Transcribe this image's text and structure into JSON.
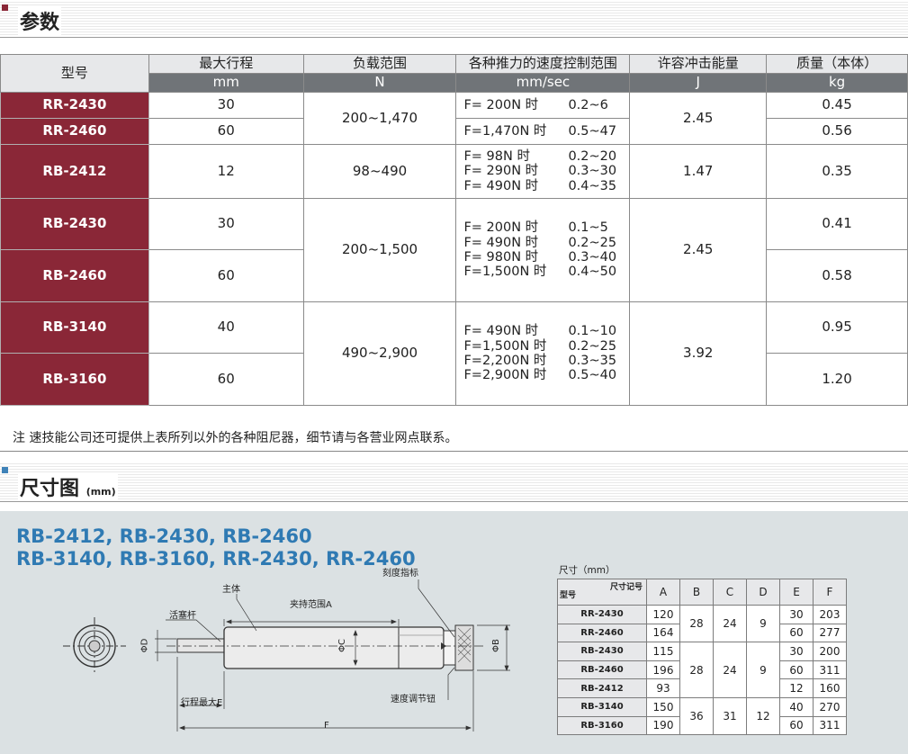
{
  "colors": {
    "accent_red": "#8a2737",
    "accent_blue": "#2f7ab3",
    "header_dark": "#707478",
    "section_square_1": "#8a2737",
    "section_square_2": "#3f82b8"
  },
  "sections": {
    "params": "参数",
    "dims": "尺寸图",
    "dims_unit": "(mm)"
  },
  "spec": {
    "headers": [
      "型号",
      "最大行程",
      "负载范围",
      "各种推力的速度控制范围",
      "许容冲击能量",
      "质量（本体）"
    ],
    "units": [
      "mm",
      "N",
      "mm/sec",
      "J",
      "kg"
    ],
    "models": [
      "RR-2430",
      "RR-2460",
      "RB-2412",
      "RB-2430",
      "RB-2460",
      "RB-3140",
      "RB-3160"
    ],
    "strokes": [
      "30",
      "60",
      "12",
      "30",
      "60",
      "40",
      "60"
    ],
    "masses": [
      "0.45",
      "0.56",
      "0.35",
      "0.41",
      "0.58",
      "0.95",
      "1.20"
    ],
    "loads": [
      "200~1,470",
      "98~490",
      "200~1,500",
      "490~2,900"
    ],
    "energies": [
      "2.45",
      "1.47",
      "2.45",
      "3.92"
    ],
    "speed": [
      [
        [
          "F=  200N 时",
          "0.2~6"
        ]
      ],
      [
        [
          "F=1,470N 时",
          "0.5~47"
        ]
      ],
      [
        [
          "F=    98N 时",
          "0.2~20"
        ],
        [
          "F=  290N 时",
          "0.3~30"
        ],
        [
          "F=  490N 时",
          "0.4~35"
        ]
      ],
      [
        [
          "F=  200N 时",
          "0.1~5"
        ],
        [
          "F=  490N 时",
          "0.2~25"
        ],
        [
          "F=  980N 时",
          "0.3~40"
        ],
        [
          "F=1,500N 时",
          "0.4~50"
        ]
      ],
      [
        [
          "F=  490N 时",
          "0.1~10"
        ],
        [
          "F=1,500N 时",
          "0.2~25"
        ],
        [
          "F=2,200N 时",
          "0.3~35"
        ],
        [
          "F=2,900N 时",
          "0.5~40"
        ]
      ]
    ]
  },
  "note": "注   速技能公司还可提供上表所列以外的各种阻尼器，细节请与各营业网点联系。",
  "drawing": {
    "title_line1": "RB-2412, RB-2430, RB-2460",
    "title_line2": "RB-3140, RB-3160, RR-2430, RR-2460",
    "labels": {
      "scale": "刻度指标",
      "body": "主体",
      "clamp": "夹持范围A",
      "rod": "活塞杆",
      "phiD": "ΦD",
      "phiC": "ΦC",
      "phiB": "ΦB",
      "stroke": "行程最大E",
      "knob": "速度调节钮",
      "F": "F"
    }
  },
  "dims": {
    "caption": "尺寸（mm）",
    "corner_top": "尺寸记号",
    "corner_bottom": "型号",
    "cols": [
      "A",
      "B",
      "C",
      "D",
      "E",
      "F"
    ],
    "models": [
      "RR-2430",
      "RR-2460",
      "RB-2430",
      "RB-2460",
      "RB-2412",
      "RB-3140",
      "RB-3160"
    ],
    "A": [
      "120",
      "164",
      "115",
      "196",
      "93",
      "150",
      "190"
    ],
    "B": [
      "28",
      "28",
      "36"
    ],
    "C": [
      "24",
      "24",
      "31"
    ],
    "D": [
      "9",
      "9",
      "12"
    ],
    "E": [
      "30",
      "60",
      "30",
      "60",
      "12",
      "40",
      "60"
    ],
    "F": [
      "203",
      "277",
      "200",
      "311",
      "160",
      "270",
      "311"
    ]
  }
}
